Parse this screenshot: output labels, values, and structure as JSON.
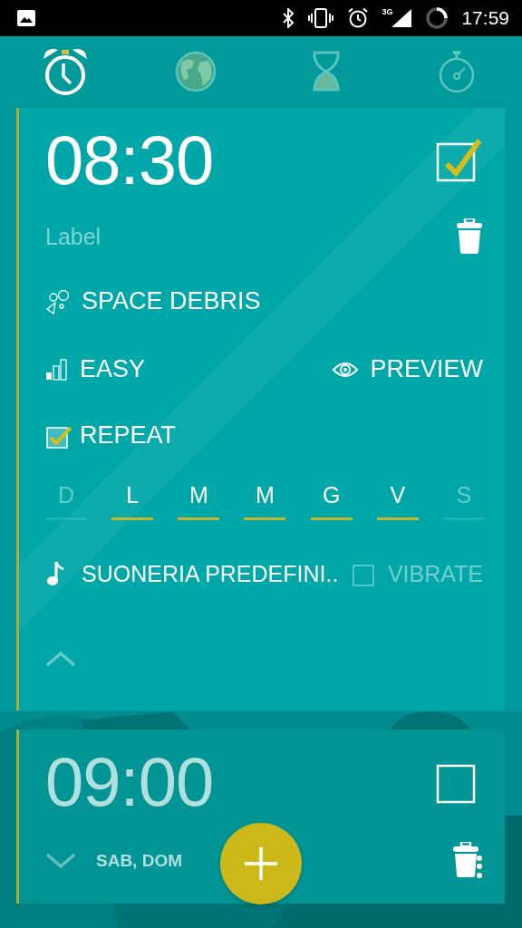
{
  "status_bar": {
    "network": "3G",
    "time": "17:59"
  },
  "tabs": [
    {
      "kind": "alarm",
      "selected": true
    },
    {
      "kind": "world",
      "selected": false
    },
    {
      "kind": "timer",
      "selected": false
    },
    {
      "kind": "stopwatch",
      "selected": false
    }
  ],
  "alarms": [
    {
      "time": "08:30",
      "enabled": true,
      "expanded": true,
      "label_placeholder": "Label",
      "puzzle": "SPACE DEBRIS",
      "difficulty": "EASY",
      "preview": "PREVIEW",
      "repeat": {
        "label": "REPEAT",
        "checked": true
      },
      "days": [
        {
          "letter": "D",
          "selected": false
        },
        {
          "letter": "L",
          "selected": true
        },
        {
          "letter": "M",
          "selected": true
        },
        {
          "letter": "M",
          "selected": true
        },
        {
          "letter": "G",
          "selected": true
        },
        {
          "letter": "V",
          "selected": true
        },
        {
          "letter": "S",
          "selected": false
        }
      ],
      "ringtone": "SUONERIA PREDEFINI..",
      "vibrate": {
        "label": "VIBRATE",
        "checked": false
      }
    },
    {
      "time": "09:00",
      "enabled": false,
      "expanded": false,
      "days_summary": "SAB, DOM"
    }
  ]
}
